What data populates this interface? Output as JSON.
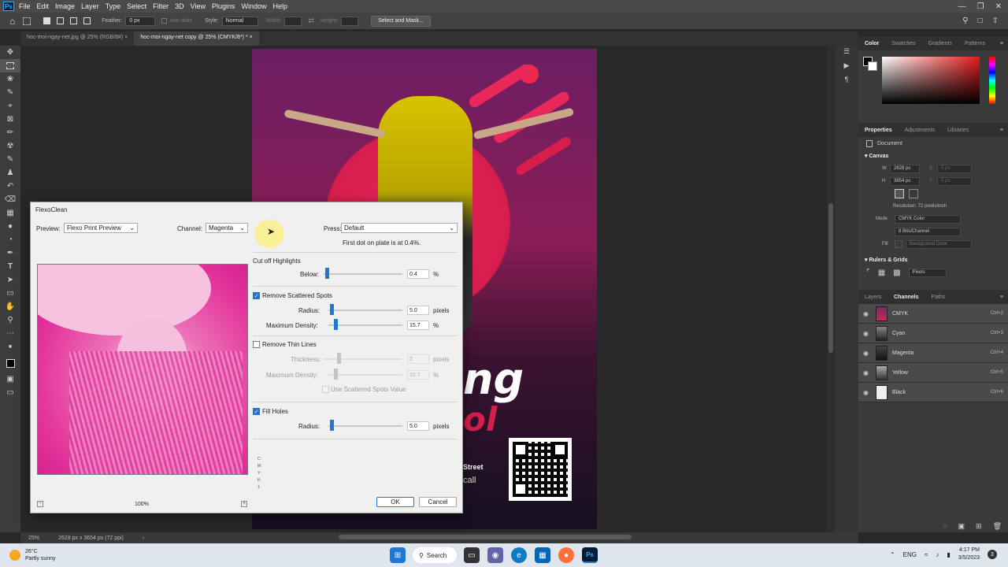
{
  "menu": {
    "items": [
      "File",
      "Edit",
      "Image",
      "Layer",
      "Type",
      "Select",
      "Filter",
      "3D",
      "View",
      "Plugins",
      "Window",
      "Help"
    ]
  },
  "options": {
    "feather_label": "Feather:",
    "feather_value": "0 px",
    "antialias_label": "Anti-alias",
    "style_label": "Style:",
    "style_value": "Normal",
    "width_label": "Width:",
    "height_label": "Height:",
    "select_mask_label": "Select and Mask..."
  },
  "doc_tabs": [
    {
      "label": "hoc-moi-ngay-net.jpg @ 25% (RGB/8#)"
    },
    {
      "label": "hoc-moi-ngay-net copy @ 25% (CMYK/8*) *"
    }
  ],
  "poster": {
    "title_part": "ng",
    "title_part2": "ol",
    "street": "Street",
    "call": "call"
  },
  "status": {
    "zoom": "25%",
    "doc_info": "2628 px x 3654 px (72 ppi)"
  },
  "right": {
    "color_tabs": [
      "Color",
      "Swatches",
      "Gradients",
      "Patterns"
    ],
    "prop_tabs": [
      "Properties",
      "Adjustments",
      "Libraries"
    ],
    "document_label": "Document",
    "canvas_title": "Canvas",
    "w_label": "W",
    "w_value": "2628 px",
    "x_label": "X",
    "x_placeholder": "0 px",
    "h_label": "H",
    "h_value": "3654 px",
    "y_label": "Y",
    "y_placeholder": "0 px",
    "resolution": "Resolution: 72 pixels/inch",
    "mode_label": "Mode",
    "mode_value": "CMYK Color",
    "depth_value": "8 Bits/Channel",
    "fill_label": "Fill",
    "fill_value": "Background Color",
    "rulers_title": "Rulers & Grids",
    "units_value": "Pixels",
    "layer_tabs": [
      "Layers",
      "Channels",
      "Paths"
    ],
    "channels": [
      {
        "name": "CMYK",
        "shortcut": "Ctrl+2"
      },
      {
        "name": "Cyan",
        "shortcut": "Ctrl+3"
      },
      {
        "name": "Magenta",
        "shortcut": "Ctrl+4"
      },
      {
        "name": "Yellow",
        "shortcut": "Ctrl+5"
      },
      {
        "name": "Black",
        "shortcut": "Ctrl+6"
      }
    ]
  },
  "dialog": {
    "title": "FlexoClean",
    "preview_label": "Preview:",
    "preview_value": "Flexo Print Preview",
    "channel_label": "Channel:",
    "channel_value": "Magenta",
    "press_label": "Press:",
    "press_value": "Default",
    "first_dot": "First dot on plate is at 0.4%.",
    "cutoff_title": "Cut off Highlights",
    "below_label": "Below:",
    "below_value": "0.4",
    "below_unit": "%",
    "scattered_label": "Remove Scattered Spots",
    "radius_label": "Radius:",
    "radius_value": "5.0",
    "radius_unit": "pixels",
    "maxdens_label": "Maximum Density:",
    "maxdens_value": "15.7",
    "maxdens_unit": "%",
    "thin_label": "Remove Thin Lines",
    "thickness_label": "Thickness:",
    "thickness_value": "2",
    "thickness_unit": "pixels",
    "maxdens2_label": "Maximum Density:",
    "maxdens2_value": "15.7",
    "maxdens2_unit": "%",
    "use_scattered_label": "Use Scattered Spots Value",
    "fill_label": "Fill Holes",
    "fill_radius_label": "Radius:",
    "fill_radius_value": "5.0",
    "fill_radius_unit": "pixels",
    "readout": [
      "C:",
      "M:",
      "Y:",
      "K:",
      "1:"
    ],
    "zoom": "100%",
    "ok_label": "OK",
    "cancel_label": "Cancel"
  },
  "taskbar": {
    "temp": "26°C",
    "weather": "Partly sunny",
    "search_label": "Search",
    "lang": "ENG",
    "time": "4:17 PM",
    "date": "3/5/2023",
    "notif": "3"
  }
}
